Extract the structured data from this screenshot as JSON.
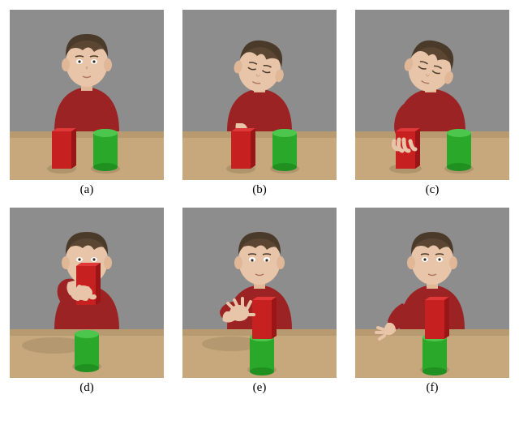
{
  "figure": {
    "panels": [
      {
        "id": "panel-a",
        "label": "(a)"
      },
      {
        "id": "panel-b",
        "label": "(b)"
      },
      {
        "id": "panel-c",
        "label": "(c)"
      },
      {
        "id": "panel-d",
        "label": "(d)"
      },
      {
        "id": "panel-e",
        "label": "(e)"
      },
      {
        "id": "panel-f",
        "label": "(f)"
      }
    ],
    "scene": {
      "background_color": "#8d8d8d",
      "table_color": "#c7a87c",
      "shirt_color": "#9c2323",
      "hair_color": "#4a3a2a",
      "skin_color": "#e8c5a8",
      "red_block_color": "#c62020",
      "green_cylinder_color": "#2aa82a"
    },
    "description": "Six-frame sequence of a 3D-rendered boy at a wooden table stacking a red cuboid on a green cylinder."
  }
}
